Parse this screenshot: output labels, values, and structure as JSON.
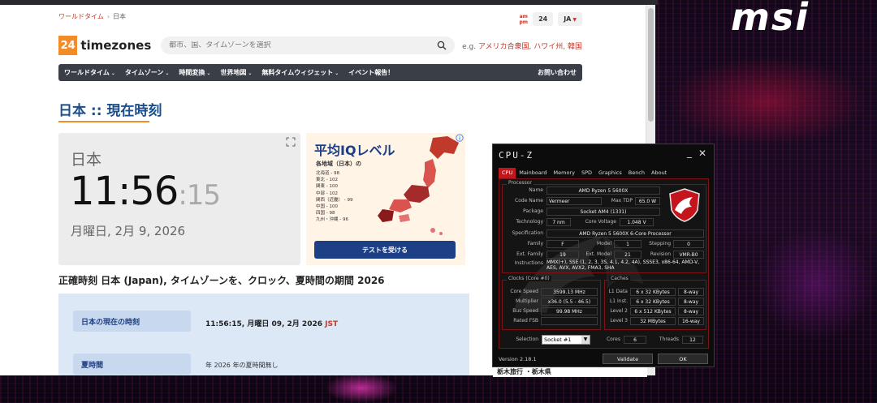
{
  "desktop": {
    "brand_logo": "msi"
  },
  "browser": {
    "breadcrumb": [
      "ワールドタイム",
      "日本"
    ],
    "ampm": [
      "am",
      "pm"
    ],
    "hour_format": "24",
    "language": "JA",
    "logo_num": "24",
    "logo_text": "timezones",
    "search_placeholder": "都市、国、タイムゾーンを選択",
    "eg_label": "e.g.",
    "eg_links": [
      "アメリカ合衆国",
      "ハワイ州",
      "韓国"
    ],
    "nav": [
      "ワールドタイム",
      "タイムゾーン",
      "時間変換",
      "世界地図",
      "無料タイムウィジェット",
      "イベント報告！"
    ],
    "nav_contact": "お問い合わせ",
    "page_title": "日本 :: 現在時刻",
    "clock": {
      "country": "日本",
      "time_hm": "11:56",
      "time_s": ":15",
      "date": "月曜日, 2月 9, 2026"
    },
    "ad": {
      "title": "平均IQレベル",
      "subtitle": "各地域（日本）の",
      "regions": [
        "北海道 - 98",
        "東北 - 102",
        "関東 - 100",
        "中部 - 102",
        "関西（近畿） - 99",
        "中国 - 100",
        "四国 - 98",
        "九州・沖縄 - 96"
      ],
      "button": "テストを受ける"
    },
    "subtitle": "正確時刻 日本 (Japan), タイムゾーンを、クロック、夏時間の期間 2026",
    "info": [
      {
        "label": "日本の現在の時刻",
        "value": "11:56:15, 月曜日 09, 2月 2026",
        "tz": "JST"
      },
      {
        "label": "夏時間",
        "value": "年 2026 年の夏時間無し"
      }
    ],
    "strip_text": "栃木旅行 ・栃木県"
  },
  "cpuz": {
    "title": "CPU-Z",
    "tabs": [
      "CPU",
      "Mainboard",
      "Memory",
      "SPD",
      "Graphics",
      "Bench",
      "About"
    ],
    "processor_group": "Processor",
    "name_label": "Name",
    "name": "AMD Ryzen 5 5600X",
    "codename_label": "Code Name",
    "codename": "Vermeer",
    "maxtdp_label": "Max TDP",
    "maxtdp": "65.0 W",
    "package_label": "Package",
    "package": "Socket AM4 (1331)",
    "technology_label": "Technology",
    "technology": "7 nm",
    "corevoltage_label": "Core Voltage",
    "corevoltage": "1.048 V",
    "spec_label": "Specification",
    "spec": "AMD Ryzen 5 5600X 6-Core Processor",
    "family_label": "Family",
    "family": "F",
    "model_label": "Model",
    "model": "1",
    "stepping_label": "Stepping",
    "stepping": "0",
    "extfamily_label": "Ext. Family",
    "extfamily": "19",
    "extmodel_label": "Ext. Model",
    "extmodel": "21",
    "revision_label": "Revision",
    "revision": "VMR-B0",
    "instructions_label": "Instructions",
    "instructions": "MMX(+), SSE (1, 2, 3, 3S, 4.1, 4.2, 4A), SSSE3, x86-64, AMD-V, AES, AVX, AVX2, FMA3, SHA",
    "clocks_group": "Clocks (Core #0)",
    "corespeed_label": "Core Speed",
    "corespeed": "3599.13 MHz",
    "multiplier_label": "Multiplier",
    "multiplier": "x36.0 (5.5 - 46.5)",
    "busspeed_label": "Bus Speed",
    "busspeed": "99.98 MHz",
    "ratedfsb_label": "Rated FSB",
    "caches_group": "Caches",
    "l1data_label": "L1 Data",
    "l1data": "6 x 32 KBytes",
    "l1data_way": "8-way",
    "l1inst_label": "L1 Inst.",
    "l1inst": "6 x 32 KBytes",
    "l1inst_way": "8-way",
    "l2_label": "Level 2",
    "l2": "6 x 512 KBytes",
    "l2_way": "8-way",
    "l3_label": "Level 3",
    "l3": "32 MBytes",
    "l3_way": "16-way",
    "selection_label": "Selection",
    "selection": "Socket #1",
    "cores_label": "Cores",
    "cores": "6",
    "threads_label": "Threads",
    "threads": "12",
    "version": "Version 2.18.1",
    "validate": "Validate",
    "ok": "OK"
  }
}
